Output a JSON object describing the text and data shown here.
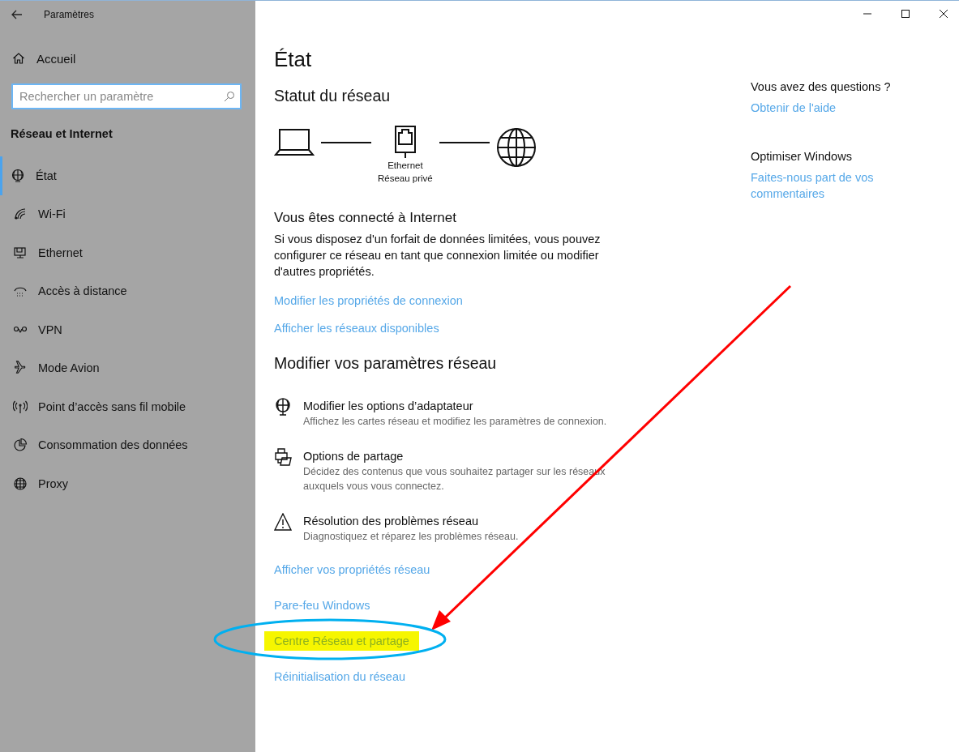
{
  "window": {
    "title": "Paramètres"
  },
  "sidebar": {
    "home": "Accueil",
    "search": {
      "placeholder": "Rechercher un paramètre"
    },
    "section": "Réseau et Internet",
    "items": [
      {
        "label": "État",
        "selected": true
      },
      {
        "label": "Wi-Fi",
        "selected": false
      },
      {
        "label": "Ethernet",
        "selected": false
      },
      {
        "label": "Accès à distance",
        "selected": false
      },
      {
        "label": "VPN",
        "selected": false
      },
      {
        "label": "Mode Avion",
        "selected": false
      },
      {
        "label": "Point d’accès sans fil mobile",
        "selected": false
      },
      {
        "label": "Consommation des données",
        "selected": false
      },
      {
        "label": "Proxy",
        "selected": false
      }
    ]
  },
  "main": {
    "title": "État",
    "status_heading": "Statut du réseau",
    "diagram": {
      "adapter_lines": [
        "Ethernet",
        "Réseau privé"
      ]
    },
    "connected_heading": "Vous êtes connecté à Internet",
    "connected_text": "Si vous disposez d'un forfait de données limitées, vous pouvez configurer ce réseau en tant que connexion limitée ou modifier d'autres propriétés.",
    "status_links": [
      "Modifier les propriétés de connexion",
      "Afficher les réseaux disponibles"
    ],
    "change_heading": "Modifier vos paramètres réseau",
    "options": [
      {
        "title": "Modifier les options d’adaptateur",
        "description": "Affichez les cartes réseau et modifiez les paramètres de connexion."
      },
      {
        "title": "Options de partage",
        "description": "Décidez des contenus que vous souhaitez partager sur les réseaux auxquels vous vous connectez."
      },
      {
        "title": "Résolution des problèmes réseau",
        "description": "Diagnostiquez et réparez les problèmes réseau."
      }
    ],
    "links": [
      {
        "label": "Afficher vos propriétés réseau",
        "highlighted": false
      },
      {
        "label": "Pare-feu Windows",
        "highlighted": false
      },
      {
        "label": "Centre Réseau et partage",
        "highlighted": true
      },
      {
        "label": "Réinitialisation du réseau",
        "highlighted": false
      }
    ]
  },
  "aside": [
    {
      "heading": "Vous avez des questions ?",
      "link": "Obtenir de l'aide"
    },
    {
      "heading": "Optimiser Windows",
      "link": "Faites-nous part de vos commentaires"
    }
  ]
}
